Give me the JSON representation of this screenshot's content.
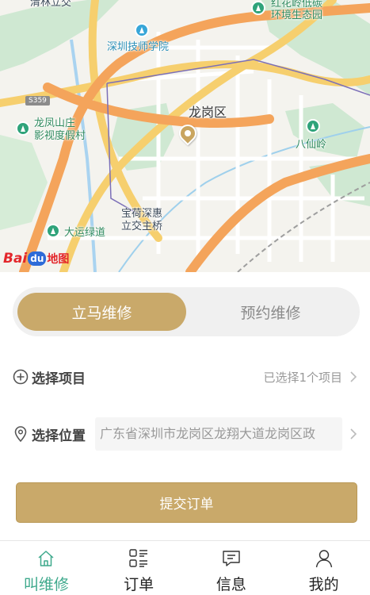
{
  "map": {
    "labels": {
      "qinglin": "清林立交",
      "honghualing": "红花岭低碳",
      "honghualing2": "环境生态园",
      "technician": "深圳技师学院",
      "road": "S359",
      "longgang": "龙岗区",
      "longfeng1": "龙凤山庄",
      "longfeng2": "影视度假村",
      "baxianling": "八仙岭",
      "baohe1": "宝荷深惠",
      "baohe2": "立交主桥",
      "dayun": "大运绿道"
    },
    "logo": {
      "bai": "Bai",
      "du": "du",
      "ditu": "地图"
    }
  },
  "segment": {
    "instant": "立马维修",
    "scheduled": "预约维修",
    "active": "instant"
  },
  "project": {
    "label": "选择项目",
    "value": "已选择1个项目"
  },
  "location": {
    "label": "选择位置",
    "value": "广东省深圳市龙岗区龙翔大道龙岗区政"
  },
  "submit": {
    "label": "提交订单"
  },
  "tabbar": {
    "items": [
      {
        "label": "叫维修",
        "icon": "home-icon",
        "active": true
      },
      {
        "label": "订单",
        "icon": "order-list-icon",
        "active": false
      },
      {
        "label": "信息",
        "icon": "message-icon",
        "active": false
      },
      {
        "label": "我的",
        "icon": "user-icon",
        "active": false
      }
    ]
  },
  "colors": {
    "accent": "#c9a96a",
    "active_tab": "#3ea98c",
    "pin": "#c9a560"
  }
}
